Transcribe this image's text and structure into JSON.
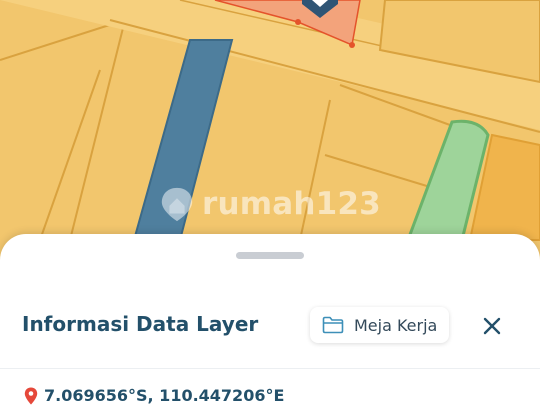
{
  "map": {
    "watermark_text": "rumah123",
    "colors": {
      "parcel": "#f2c66d",
      "parcel_border": "#d9a23f",
      "road": "#f6d07e",
      "river": "#4f7f9e",
      "green": "#9ed49a",
      "orange": "#f0b44c",
      "selected": "#f3a37b",
      "marker": "#2f5575",
      "vertex": "#e4532b"
    }
  },
  "sheet": {
    "title": "Informasi Data Layer",
    "workspace_button_label": "Meja Kerja",
    "workspace_icon": "folder-icon",
    "close_icon": "close-icon",
    "location_icon": "map-pin-icon",
    "coordinates": "7.069656°S, 110.447206°E"
  }
}
